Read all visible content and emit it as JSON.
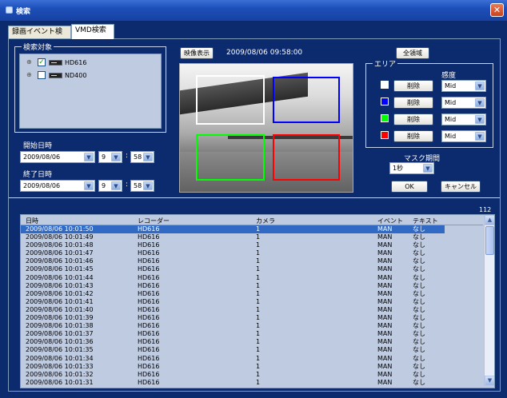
{
  "window": {
    "title": "検索",
    "close_label": "✕"
  },
  "tabs": [
    {
      "label": "録画イベント検索",
      "active": false
    },
    {
      "label": "VMD検索",
      "active": true
    }
  ],
  "search_target": {
    "legend": "検索対象",
    "items": [
      {
        "label": "HD616",
        "checked": true,
        "check_mark": "✓"
      },
      {
        "label": "ND400",
        "checked": false,
        "check_mark": ""
      }
    ],
    "expander": "⊕"
  },
  "start": {
    "label": "開始日時",
    "date": "2009/08/06",
    "hour": "9",
    "minute": "58"
  },
  "end": {
    "label": "終了日時",
    "date": "2009/08/06",
    "hour": "9",
    "minute": "58"
  },
  "time_separator": ":",
  "video": {
    "show_button": "映像表示",
    "timestamp": "2009/08/06 09:58:00"
  },
  "all_areas_button": "全領域",
  "area": {
    "legend": "エリア",
    "sensitivity_label": "感度",
    "rows": [
      {
        "color": "#ffffff",
        "delete_label": "削除",
        "sensitivity": "Mid"
      },
      {
        "color": "#0000ff",
        "delete_label": "削除",
        "sensitivity": "Mid"
      },
      {
        "color": "#00ff00",
        "delete_label": "削除",
        "sensitivity": "Mid"
      },
      {
        "color": "#ff0000",
        "delete_label": "削除",
        "sensitivity": "Mid"
      }
    ]
  },
  "mask_period": {
    "label": "マスク期間",
    "value": "1秒"
  },
  "ok_button": "OK",
  "cancel_button": "キャンセル",
  "result_count": "112",
  "results": {
    "columns": [
      "日時",
      "レコーダー",
      "カメラ",
      "イベント",
      "テキスト"
    ],
    "rows": [
      [
        "2009/08/06 10:01:50",
        "HD616",
        "1",
        "MAN",
        "なし"
      ],
      [
        "2009/08/06 10:01:49",
        "HD616",
        "1",
        "MAN",
        "なし"
      ],
      [
        "2009/08/06 10:01:48",
        "HD616",
        "1",
        "MAN",
        "なし"
      ],
      [
        "2009/08/06 10:01:47",
        "HD616",
        "1",
        "MAN",
        "なし"
      ],
      [
        "2009/08/06 10:01:46",
        "HD616",
        "1",
        "MAN",
        "なし"
      ],
      [
        "2009/08/06 10:01:45",
        "HD616",
        "1",
        "MAN",
        "なし"
      ],
      [
        "2009/08/06 10:01:44",
        "HD616",
        "1",
        "MAN",
        "なし"
      ],
      [
        "2009/08/06 10:01:43",
        "HD616",
        "1",
        "MAN",
        "なし"
      ],
      [
        "2009/08/06 10:01:42",
        "HD616",
        "1",
        "MAN",
        "なし"
      ],
      [
        "2009/08/06 10:01:41",
        "HD616",
        "1",
        "MAN",
        "なし"
      ],
      [
        "2009/08/06 10:01:40",
        "HD616",
        "1",
        "MAN",
        "なし"
      ],
      [
        "2009/08/06 10:01:39",
        "HD616",
        "1",
        "MAN",
        "なし"
      ],
      [
        "2009/08/06 10:01:38",
        "HD616",
        "1",
        "MAN",
        "なし"
      ],
      [
        "2009/08/06 10:01:37",
        "HD616",
        "1",
        "MAN",
        "なし"
      ],
      [
        "2009/08/06 10:01:36",
        "HD616",
        "1",
        "MAN",
        "なし"
      ],
      [
        "2009/08/06 10:01:35",
        "HD616",
        "1",
        "MAN",
        "なし"
      ],
      [
        "2009/08/06 10:01:34",
        "HD616",
        "1",
        "MAN",
        "なし"
      ],
      [
        "2009/08/06 10:01:33",
        "HD616",
        "1",
        "MAN",
        "なし"
      ],
      [
        "2009/08/06 10:01:32",
        "HD616",
        "1",
        "MAN",
        "なし"
      ],
      [
        "2009/08/06 10:01:31",
        "HD616",
        "1",
        "MAN",
        "なし"
      ]
    ],
    "selected_index": 0
  },
  "icons": {
    "dropdown": "▼",
    "scroll_up": "▲",
    "scroll_down": "▼"
  }
}
